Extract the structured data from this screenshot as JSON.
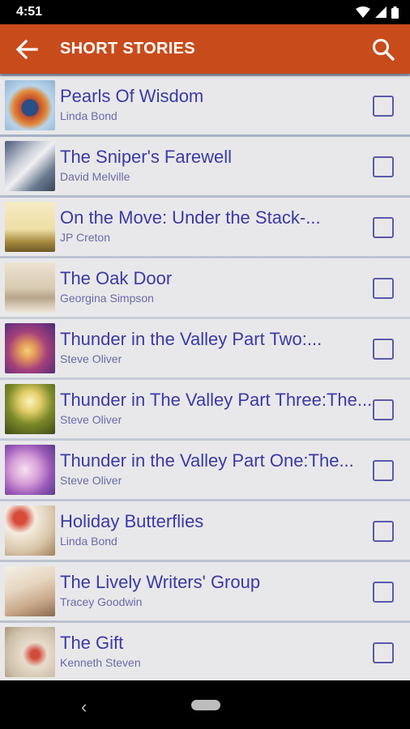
{
  "status_bar": {
    "time": "4:51"
  },
  "app_bar": {
    "title": "SHORT STORIES",
    "back_icon": "arrow-back-icon",
    "search_icon": "search-icon"
  },
  "colors": {
    "app_bar": "#c84b1c",
    "title_text": "#3a3aa6",
    "author_text": "#6a6aaa",
    "row_bg": "#e8e8ea"
  },
  "stories": [
    {
      "title": "Pearls Of Wisdom",
      "author": "Linda Bond",
      "checked": false
    },
    {
      "title": "The Sniper's Farewell",
      "author": "David Melville",
      "checked": false
    },
    {
      "title": "On the Move: Under the Stack-...",
      "author": "JP Creton",
      "checked": false
    },
    {
      "title": "The Oak Door",
      "author": "Georgina Simpson",
      "checked": false
    },
    {
      "title": "Thunder in the Valley Part Two:...",
      "author": "Steve Oliver",
      "checked": false
    },
    {
      "title": "Thunder in The Valley Part Three:The...",
      "author": "Steve Oliver",
      "checked": false
    },
    {
      "title": "Thunder in the Valley Part One:The...",
      "author": "Steve Oliver",
      "checked": false
    },
    {
      "title": "Holiday Butterflies",
      "author": "Linda Bond",
      "checked": false
    },
    {
      "title": "The Lively Writers' Group",
      "author": "Tracey Goodwin",
      "checked": false
    },
    {
      "title": "The Gift",
      "author": "Kenneth Steven",
      "checked": false
    }
  ]
}
